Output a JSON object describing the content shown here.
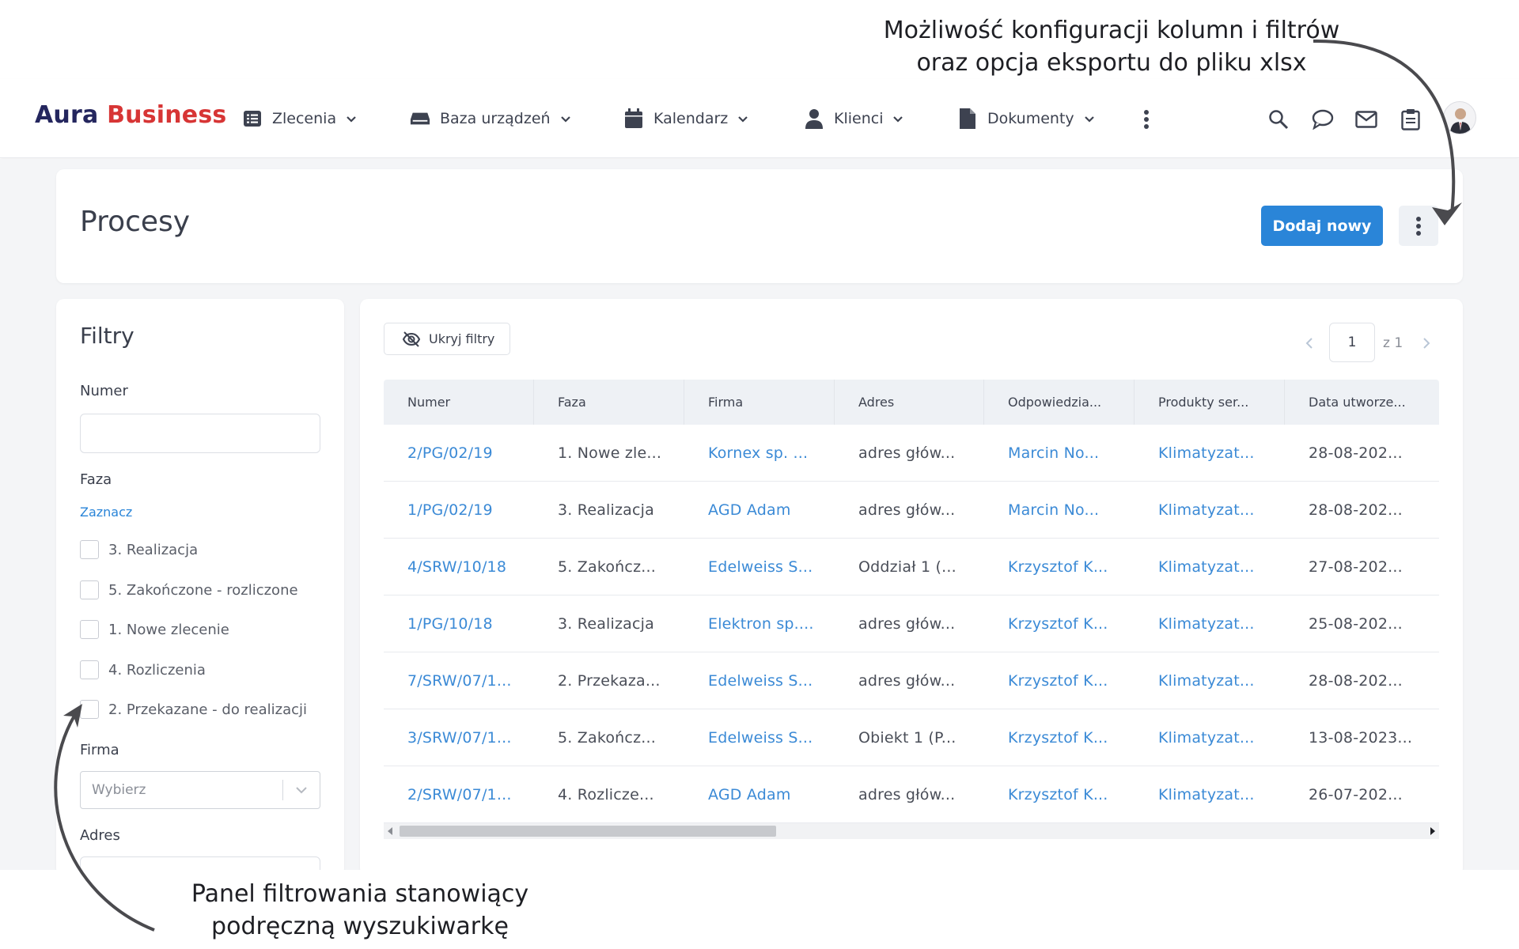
{
  "annotations": {
    "top_line1": "Możliwość konfiguracji kolumn i filtrów",
    "top_line2": "oraz opcja eksportu do pliku xlsx",
    "bottom_line1": "Panel filtrowania stanowiący",
    "bottom_line2": "podręczną wyszukiwarkę"
  },
  "logo": {
    "part1": "Aura",
    "part2": "Business"
  },
  "nav": {
    "items": [
      {
        "label": "Zlecenia",
        "icon": "list-icon"
      },
      {
        "label": "Baza urządzeń",
        "icon": "device-icon"
      },
      {
        "label": "Kalendarz",
        "icon": "calendar-icon"
      },
      {
        "label": "Klienci",
        "icon": "user-icon"
      },
      {
        "label": "Dokumenty",
        "icon": "document-icon"
      }
    ],
    "right_icons": [
      "search-icon",
      "chat-icon",
      "mail-icon",
      "clipboard-icon"
    ]
  },
  "header": {
    "title": "Procesy",
    "add_button": "Dodaj nowy"
  },
  "filters": {
    "title": "Filtry",
    "numer_label": "Numer",
    "faza_label": "Faza",
    "select_link": "Zaznacz",
    "phases": [
      "3. Realizacja",
      "5. Zakończone - rozliczone",
      "1. Nowe zlecenie",
      "4. Rozliczenia",
      "2. Przekazane - do realizacji"
    ],
    "firma_label": "Firma",
    "firma_placeholder": "Wybierz",
    "adres_label": "Adres"
  },
  "table": {
    "hide_filters": "Ukryj filtry",
    "page": "1",
    "page_of": "z 1",
    "columns": [
      "Numer",
      "Faza",
      "Firma",
      "Adres",
      "Odpowiedzia...",
      "Produkty ser...",
      "Data utworze..."
    ],
    "rows": [
      [
        "2/PG/02/19",
        "1. Nowe zle...",
        "Kornex sp. ...",
        "adres głów...",
        "Marcin No...",
        "Klimatyzat...",
        "28-08-202..."
      ],
      [
        "1/PG/02/19",
        "3. Realizacja",
        "AGD Adam",
        "adres głów...",
        "Marcin No...",
        "Klimatyzat...",
        "28-08-202..."
      ],
      [
        "4/SRW/10/18",
        "5. Zakończ...",
        "Edelweiss S...",
        "Oddział 1 (...",
        "Krzysztof K...",
        "Klimatyzat...",
        "27-08-202..."
      ],
      [
        "1/PG/10/18",
        "3. Realizacja",
        "Elektron sp....",
        "adres głów...",
        "Krzysztof K...",
        "Klimatyzat...",
        "25-08-202..."
      ],
      [
        "7/SRW/07/1...",
        "2. Przekaza...",
        "Edelweiss S...",
        "adres głów...",
        "Krzysztof K...",
        "Klimatyzat...",
        "28-08-202..."
      ],
      [
        "3/SRW/07/1...",
        "5. Zakończ...",
        "Edelweiss S...",
        "Obiekt 1 (P...",
        "Krzysztof K...",
        "Klimatyzat...",
        "13-08-2023..."
      ],
      [
        "2/SRW/07/1...",
        "4. Rozlicze...",
        "AGD Adam",
        "adres głów...",
        "Krzysztof K...",
        "Klimatyzat...",
        "26-07-202..."
      ]
    ]
  },
  "colors": {
    "brand_dark": "#24265e",
    "brand_red": "#d73535",
    "primary": "#2a85d8",
    "link": "#3b8ad6"
  }
}
